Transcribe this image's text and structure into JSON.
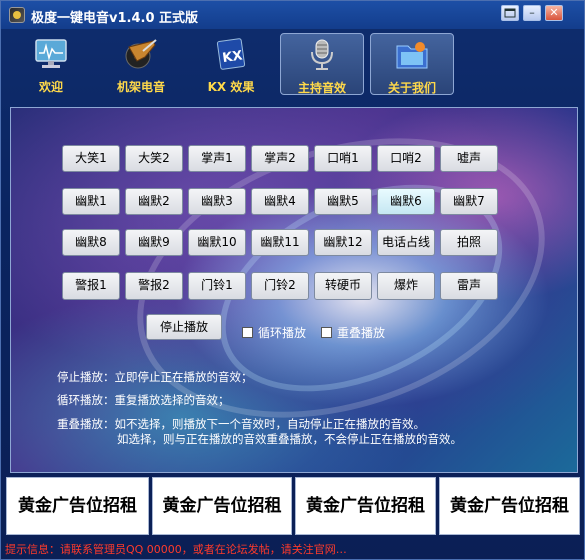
{
  "window": {
    "title": "极度一键电音v1.4.0 正式版"
  },
  "titlebar_buttons": {
    "menu": "",
    "minimize": "–",
    "close": "✕"
  },
  "toolbar": [
    {
      "label": "欢迎",
      "icon": "monitor-icon"
    },
    {
      "label": "机架电音",
      "icon": "guitar-disc-icon"
    },
    {
      "label": "KX 效果",
      "icon": "kx-logo-icon"
    },
    {
      "label": "主持音效",
      "icon": "microphone-icon",
      "active": true
    },
    {
      "label": "关于我们",
      "icon": "folder-icon"
    }
  ],
  "sound_buttons": [
    [
      "大笑1",
      "大笑2",
      "掌声1",
      "掌声2",
      "口哨1",
      "口哨2",
      "嘘声"
    ],
    [
      "幽默1",
      "幽默2",
      "幽默3",
      "幽默4",
      "幽默5",
      "幽默6",
      "幽默7"
    ],
    [
      "幽默8",
      "幽默9",
      "幽默10",
      "幽默11",
      "幽默12",
      "电话占线",
      "拍照"
    ],
    [
      "警报1",
      "警报2",
      "门铃1",
      "门铃2",
      "转硬币",
      "爆炸",
      "雷声"
    ]
  ],
  "controls": {
    "stop_label": "停止播放",
    "loop_label": "循环播放",
    "overlap_label": "重叠播放"
  },
  "descriptions": [
    "停止播放：立即停止正在播放的音效；",
    "循环播放：重复播放选择的音效；",
    "重叠播放：如不选择，则播放下一个音效时，自动停止正在播放的音效。",
    "如选择，则与正在播放的音效重叠播放，不会停止正在播放的音效。"
  ],
  "ads": [
    "黄金广告位招租",
    "黄金广告位招租",
    "黄金广告位招租",
    "黄金广告位招租"
  ],
  "status": "提示信息：请联系管理员QQ 00000，或者在论坛发帖，请关注官网…",
  "colors": {
    "accent_text": "#ffd94a",
    "status_text": "#ff3a2a"
  }
}
